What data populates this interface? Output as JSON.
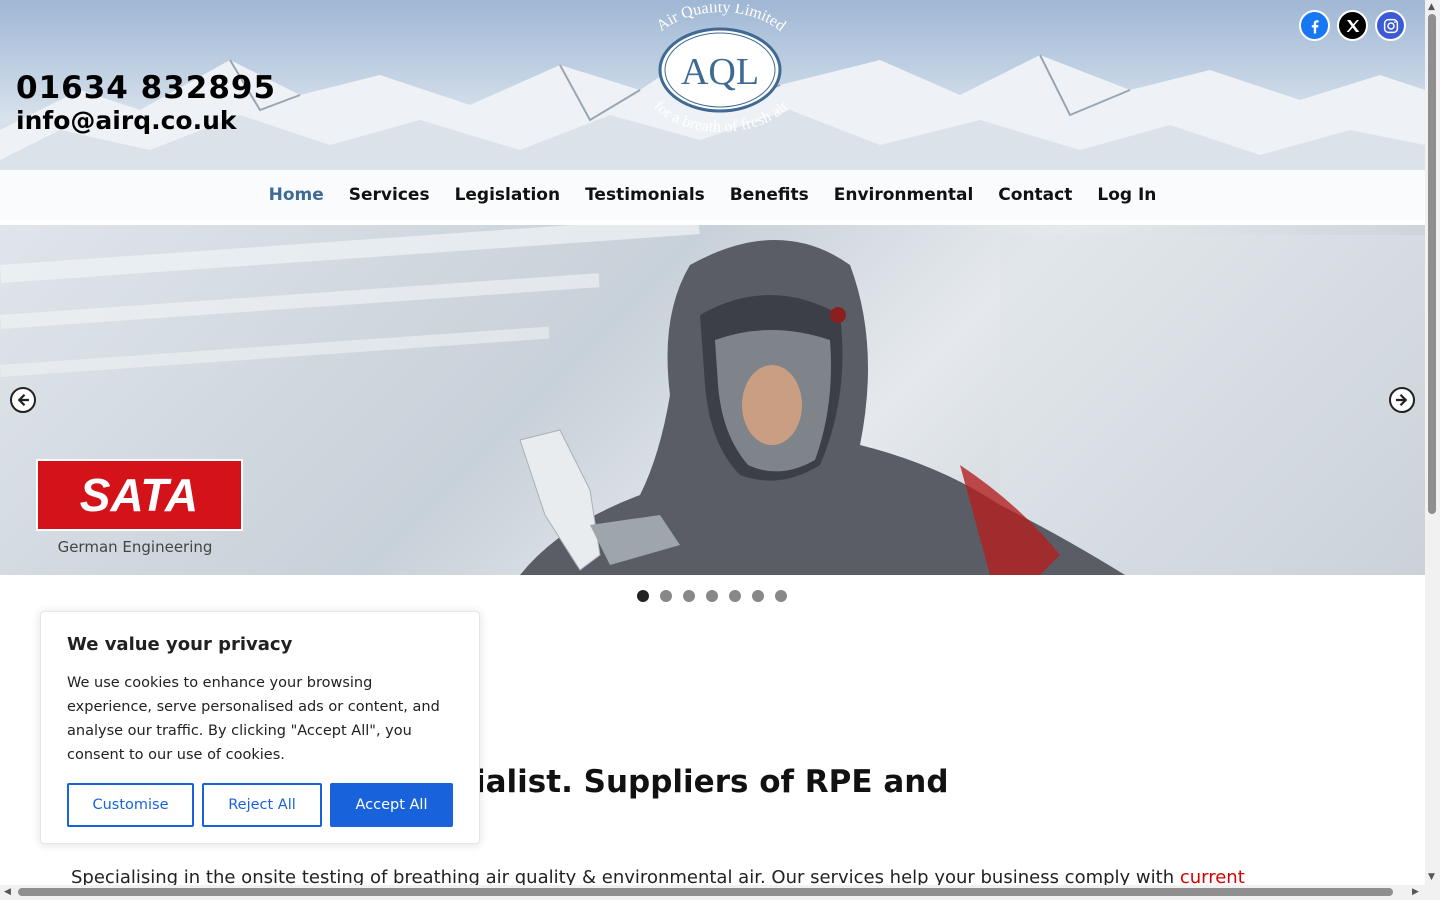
{
  "header": {
    "phone": "01634 832895",
    "email": "info@airq.co.uk",
    "logo": {
      "arc_top": "Air Quality Limited",
      "initials": "AQL",
      "arc_bottom": "for a breath of fresh air"
    },
    "social": [
      {
        "name": "facebook-icon",
        "color": "#1877f2"
      },
      {
        "name": "x-icon",
        "color": "#000000"
      },
      {
        "name": "instagram-icon",
        "color": "#3d5ad6"
      }
    ]
  },
  "nav": {
    "items": [
      "Home",
      "Services",
      "Legislation",
      "Testimonials",
      "Benefits",
      "Environmental",
      "Contact",
      "Log In"
    ],
    "active": "Home",
    "active_color": "#3f6a93"
  },
  "slider": {
    "brand_text": "SATA",
    "brand_sub": "German Engineering",
    "slide_count": 7,
    "active_slide": 1
  },
  "main": {
    "headline": "mental air testing specialist. Suppliers of RPE and",
    "intro_text": "Specialising in the onsite testing of  breathing air quality  & environmental air. Our services help your business comply with ",
    "intro_link": "current"
  },
  "cookie": {
    "title": "We value your privacy",
    "body": "We use cookies to enhance your browsing experience, serve personalised ads or content, and analyse our traffic. By clicking \"Accept All\", you consent to our use of cookies.",
    "customise_label": "Customise",
    "reject_label": "Reject All",
    "accept_label": "Accept All",
    "accent_color": "#1863dc"
  }
}
